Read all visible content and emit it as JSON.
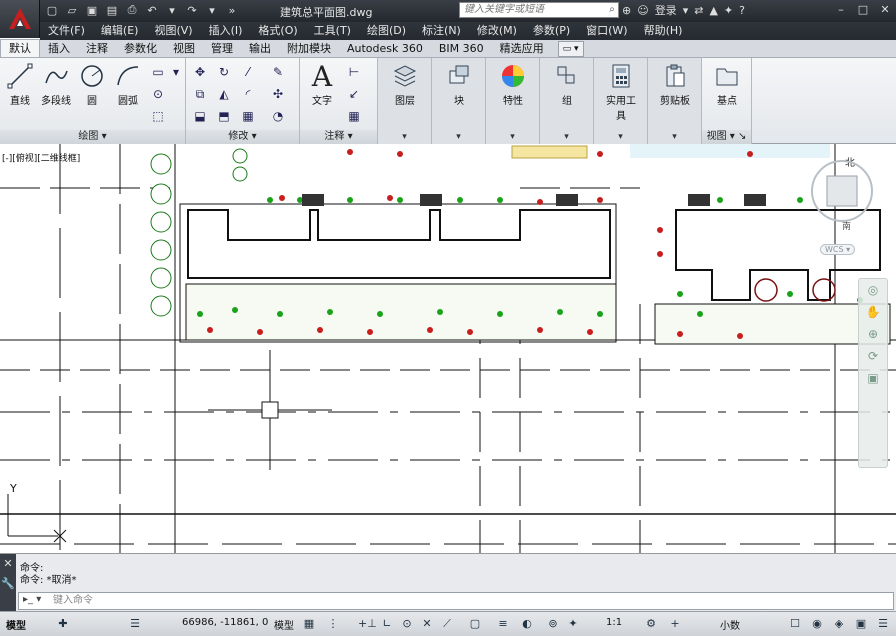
{
  "titlebar": {
    "document_title": "建筑总平面图.dwg",
    "search_placeholder": "键入关键字或短语",
    "login_label": "登录"
  },
  "menubar": {
    "items": [
      "文件(F)",
      "编辑(E)",
      "视图(V)",
      "插入(I)",
      "格式(O)",
      "工具(T)",
      "绘图(D)",
      "标注(N)",
      "修改(M)",
      "参数(P)",
      "窗口(W)",
      "帮助(H)"
    ]
  },
  "ribbon_tabs": {
    "items": [
      "默认",
      "插入",
      "注释",
      "参数化",
      "视图",
      "管理",
      "输出",
      "附加模块",
      "Autodesk 360",
      "BIM 360",
      "精选应用"
    ],
    "active_index": 0
  },
  "ribbon": {
    "draw": {
      "title": "绘图",
      "tools": [
        "直线",
        "多段线",
        "圆",
        "圆弧"
      ]
    },
    "modify": {
      "title": "修改"
    },
    "annotation": {
      "title": "注释",
      "tools": [
        "文字"
      ]
    },
    "groups": [
      "图层",
      "块",
      "特性",
      "组",
      "实用工具",
      "剪贴板",
      "基点"
    ],
    "view": {
      "title": "视图"
    }
  },
  "canvas": {
    "viewport_label": "[-][俯视][二维线框]",
    "wcs_label": "WCS",
    "viewcube_north": "北",
    "viewcube_south": "南",
    "ucs_y_label": "Y"
  },
  "command_line": {
    "history": [
      "命令:",
      "命令: *取消*"
    ],
    "placeholder": "键入命令"
  },
  "statusbar": {
    "tab_label": "模型",
    "coordinates": "66986, -11861, 0",
    "model_label": "模型",
    "scale": "1:1",
    "units": "小数"
  },
  "colors": {
    "titlebar": "#23272d",
    "ribbon": "#e4e7eb",
    "autocad_red": "#c81e1e"
  }
}
